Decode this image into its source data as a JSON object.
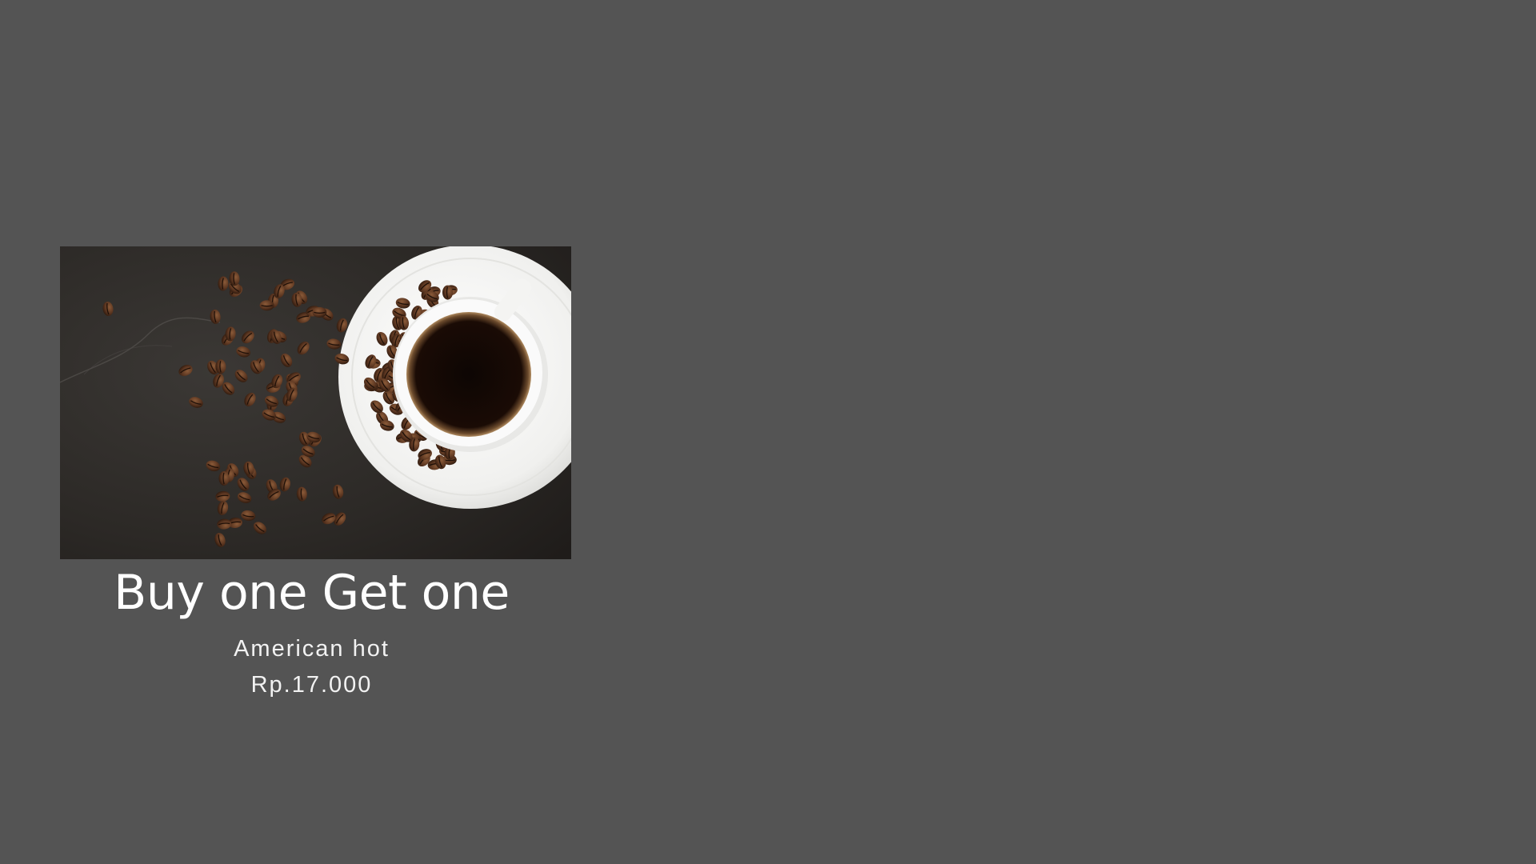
{
  "promo": {
    "title": "Buy one Get one",
    "product_name": "American hot",
    "price": "Rp.17.000",
    "image_icon": "coffee-cup-with-beans-photo"
  },
  "colors": {
    "background": "#545454",
    "text": "#ffffff",
    "table_surface": "#2a2724",
    "bean": "#5a3520",
    "coffee": "#120804",
    "saucer": "#f2f2f0"
  }
}
